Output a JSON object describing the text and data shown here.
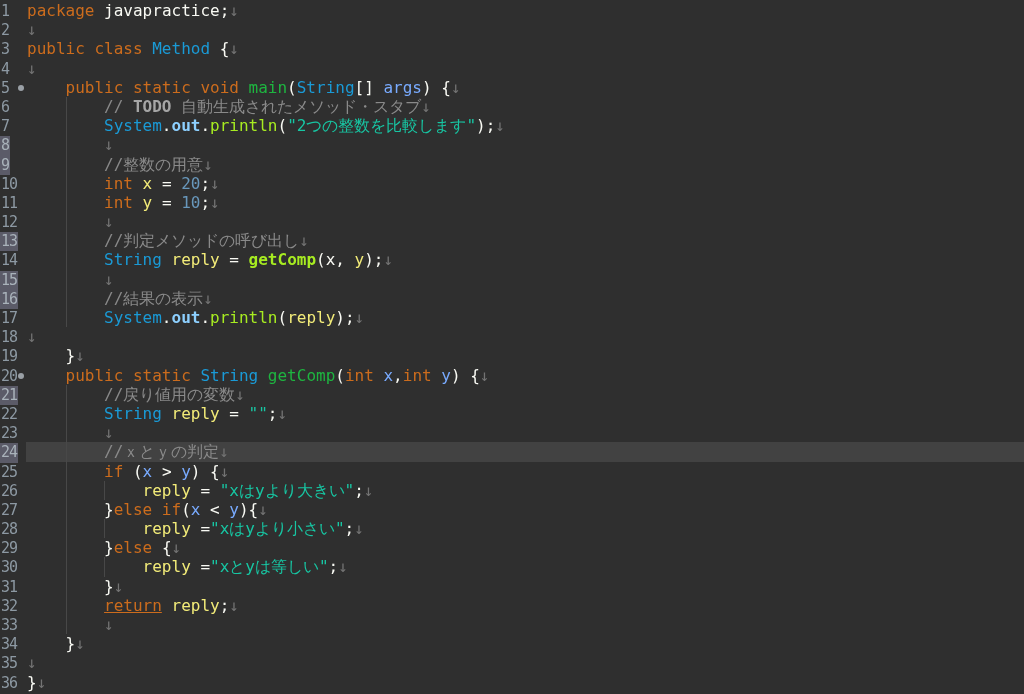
{
  "editor": {
    "lines": [
      {
        "number": "1",
        "marked": false,
        "current": false,
        "tokens": [
          {
            "kind": "keyword",
            "text": "package"
          },
          {
            "kind": "plain",
            "text": " javapractice;"
          },
          {
            "kind": "eol",
            "text": "↓"
          }
        ]
      },
      {
        "number": "2",
        "marked": false,
        "current": false,
        "tokens": [
          {
            "kind": "eol",
            "text": "↓"
          }
        ]
      },
      {
        "number": "3",
        "marked": false,
        "current": false,
        "tokens": [
          {
            "kind": "keyword",
            "text": "public class "
          },
          {
            "kind": "type",
            "text": "Method"
          },
          {
            "kind": "plain",
            "text": " {"
          },
          {
            "kind": "eol",
            "text": "↓"
          }
        ]
      },
      {
        "number": "4",
        "marked": false,
        "current": false,
        "tokens": [
          {
            "kind": "eol",
            "text": "↓"
          }
        ]
      },
      {
        "number": "5",
        "marked": false,
        "current": false,
        "fold": true,
        "tokens": [
          {
            "kind": "keyword",
            "text": "    public static void "
          },
          {
            "kind": "declaration",
            "text": "main"
          },
          {
            "kind": "plain",
            "text": "("
          },
          {
            "kind": "type",
            "text": "String"
          },
          {
            "kind": "plain",
            "text": "[] "
          },
          {
            "kind": "param",
            "text": "args"
          },
          {
            "kind": "plain",
            "text": ") {"
          },
          {
            "kind": "eol",
            "text": "↓"
          }
        ]
      },
      {
        "number": "6",
        "marked": false,
        "current": false,
        "tokens": [
          {
            "kind": "comment",
            "text": "        //"
          },
          {
            "kind": "todo",
            "text": " TODO"
          },
          {
            "kind": "comment",
            "text": " 自動生成されたメソッド・スタブ"
          },
          {
            "kind": "eol",
            "text": "↓"
          }
        ]
      },
      {
        "number": "7",
        "marked": false,
        "current": false,
        "tokens": [
          {
            "kind": "type",
            "text": "        System"
          },
          {
            "kind": "plain",
            "text": "."
          },
          {
            "kind": "field",
            "text": "out"
          },
          {
            "kind": "plain",
            "text": "."
          },
          {
            "kind": "call",
            "text": "println"
          },
          {
            "kind": "plain",
            "text": "("
          },
          {
            "kind": "string",
            "text": "\"2つの整数を比較します\""
          },
          {
            "kind": "plain",
            "text": ");"
          },
          {
            "kind": "eol",
            "text": "↓"
          }
        ]
      },
      {
        "number": "8",
        "marked": true,
        "current": false,
        "tokens": [
          {
            "kind": "eol",
            "text": "        ↓"
          }
        ]
      },
      {
        "number": "9",
        "marked": true,
        "current": false,
        "tokens": [
          {
            "kind": "comment",
            "text": "        //整数の用意"
          },
          {
            "kind": "eol",
            "text": "↓"
          }
        ]
      },
      {
        "number": "10",
        "marked": false,
        "current": false,
        "tokens": [
          {
            "kind": "keyword",
            "text": "        int "
          },
          {
            "kind": "local",
            "text": "x"
          },
          {
            "kind": "plain",
            "text": " = "
          },
          {
            "kind": "number",
            "text": "20"
          },
          {
            "kind": "plain",
            "text": ";"
          },
          {
            "kind": "eol",
            "text": "↓"
          }
        ]
      },
      {
        "number": "11",
        "marked": false,
        "current": false,
        "tokens": [
          {
            "kind": "keyword",
            "text": "        int "
          },
          {
            "kind": "local",
            "text": "y"
          },
          {
            "kind": "plain",
            "text": " = "
          },
          {
            "kind": "number",
            "text": "10"
          },
          {
            "kind": "plain",
            "text": ";"
          },
          {
            "kind": "eol",
            "text": "↓"
          }
        ]
      },
      {
        "number": "12",
        "marked": false,
        "current": false,
        "tokens": [
          {
            "kind": "eol",
            "text": "        ↓"
          }
        ]
      },
      {
        "number": "13",
        "marked": true,
        "current": false,
        "tokens": [
          {
            "kind": "comment",
            "text": "        //判定メソッドの呼び出し"
          },
          {
            "kind": "eol",
            "text": "↓"
          }
        ]
      },
      {
        "number": "14",
        "marked": false,
        "current": false,
        "tokens": [
          {
            "kind": "type",
            "text": "        String "
          },
          {
            "kind": "local",
            "text": "reply"
          },
          {
            "kind": "plain",
            "text": " = "
          },
          {
            "kind": "call-bold",
            "text": "getComp"
          },
          {
            "kind": "plain",
            "text": "(x, "
          },
          {
            "kind": "local",
            "text": "y"
          },
          {
            "kind": "plain",
            "text": ");"
          },
          {
            "kind": "eol",
            "text": "↓"
          }
        ]
      },
      {
        "number": "15",
        "marked": true,
        "current": false,
        "tokens": [
          {
            "kind": "eol",
            "text": "        ↓"
          }
        ]
      },
      {
        "number": "16",
        "marked": true,
        "current": false,
        "tokens": [
          {
            "kind": "comment",
            "text": "        //結果の表示"
          },
          {
            "kind": "eol",
            "text": "↓"
          }
        ]
      },
      {
        "number": "17",
        "marked": false,
        "current": false,
        "tokens": [
          {
            "kind": "type",
            "text": "        System"
          },
          {
            "kind": "plain",
            "text": "."
          },
          {
            "kind": "field",
            "text": "out"
          },
          {
            "kind": "plain",
            "text": "."
          },
          {
            "kind": "call",
            "text": "println"
          },
          {
            "kind": "plain",
            "text": "("
          },
          {
            "kind": "local",
            "text": "reply"
          },
          {
            "kind": "plain",
            "text": ");"
          },
          {
            "kind": "eol",
            "text": "↓"
          }
        ]
      },
      {
        "number": "18",
        "marked": false,
        "current": false,
        "tokens": [
          {
            "kind": "eol",
            "text": "↓"
          }
        ]
      },
      {
        "number": "19",
        "marked": false,
        "current": false,
        "tokens": [
          {
            "kind": "plain",
            "text": "    }"
          },
          {
            "kind": "eol",
            "text": "↓"
          }
        ]
      },
      {
        "number": "20",
        "marked": false,
        "current": false,
        "fold": true,
        "tokens": [
          {
            "kind": "keyword",
            "text": "    public static "
          },
          {
            "kind": "type",
            "text": "String "
          },
          {
            "kind": "declaration",
            "text": "getComp"
          },
          {
            "kind": "plain",
            "text": "("
          },
          {
            "kind": "keyword",
            "text": "int "
          },
          {
            "kind": "param",
            "text": "x"
          },
          {
            "kind": "plain",
            "text": ","
          },
          {
            "kind": "keyword",
            "text": "int "
          },
          {
            "kind": "param",
            "text": "y"
          },
          {
            "kind": "plain",
            "text": ") {"
          },
          {
            "kind": "eol",
            "text": "↓"
          }
        ]
      },
      {
        "number": "21",
        "marked": true,
        "current": false,
        "tokens": [
          {
            "kind": "comment",
            "text": "        //戻り値用の変数"
          },
          {
            "kind": "eol",
            "text": "↓"
          }
        ]
      },
      {
        "number": "22",
        "marked": false,
        "current": false,
        "tokens": [
          {
            "kind": "type",
            "text": "        String "
          },
          {
            "kind": "local",
            "text": "reply"
          },
          {
            "kind": "plain",
            "text": " = "
          },
          {
            "kind": "string",
            "text": "\"\""
          },
          {
            "kind": "plain",
            "text": ";"
          },
          {
            "kind": "eol",
            "text": "↓"
          }
        ]
      },
      {
        "number": "23",
        "marked": false,
        "current": false,
        "tokens": [
          {
            "kind": "eol",
            "text": "        ↓"
          }
        ]
      },
      {
        "number": "24",
        "marked": true,
        "current": true,
        "tokens": [
          {
            "kind": "comment",
            "text": "        //ｘとｙの判定"
          },
          {
            "kind": "eol",
            "text": "↓"
          }
        ]
      },
      {
        "number": "25",
        "marked": false,
        "current": false,
        "tokens": [
          {
            "kind": "keyword",
            "text": "        if"
          },
          {
            "kind": "plain",
            "text": " ("
          },
          {
            "kind": "param",
            "text": "x"
          },
          {
            "kind": "plain",
            "text": " > "
          },
          {
            "kind": "param",
            "text": "y"
          },
          {
            "kind": "plain",
            "text": ") {"
          },
          {
            "kind": "eol",
            "text": "↓"
          }
        ]
      },
      {
        "number": "26",
        "marked": false,
        "current": false,
        "tokens": [
          {
            "kind": "local",
            "text": "            reply"
          },
          {
            "kind": "plain",
            "text": " = "
          },
          {
            "kind": "string",
            "text": "\"xはyより大きい\""
          },
          {
            "kind": "plain",
            "text": ";"
          },
          {
            "kind": "eol",
            "text": "↓"
          }
        ]
      },
      {
        "number": "27",
        "marked": false,
        "current": false,
        "tokens": [
          {
            "kind": "plain",
            "text": "        }"
          },
          {
            "kind": "keyword",
            "text": "else if"
          },
          {
            "kind": "plain",
            "text": "("
          },
          {
            "kind": "param",
            "text": "x"
          },
          {
            "kind": "plain",
            "text": " < "
          },
          {
            "kind": "param",
            "text": "y"
          },
          {
            "kind": "plain",
            "text": "){"
          },
          {
            "kind": "eol",
            "text": "↓"
          }
        ]
      },
      {
        "number": "28",
        "marked": false,
        "current": false,
        "tokens": [
          {
            "kind": "local",
            "text": "            reply"
          },
          {
            "kind": "plain",
            "text": " ="
          },
          {
            "kind": "string",
            "text": "\"xはyより小さい\""
          },
          {
            "kind": "plain",
            "text": ";"
          },
          {
            "kind": "eol",
            "text": "↓"
          }
        ]
      },
      {
        "number": "29",
        "marked": false,
        "current": false,
        "tokens": [
          {
            "kind": "plain",
            "text": "        }"
          },
          {
            "kind": "keyword",
            "text": "else"
          },
          {
            "kind": "plain",
            "text": " {"
          },
          {
            "kind": "eol",
            "text": "↓"
          }
        ]
      },
      {
        "number": "30",
        "marked": false,
        "current": false,
        "tokens": [
          {
            "kind": "local",
            "text": "            reply"
          },
          {
            "kind": "plain",
            "text": " ="
          },
          {
            "kind": "string",
            "text": "\"xとyは等しい\""
          },
          {
            "kind": "plain",
            "text": ";"
          },
          {
            "kind": "eol",
            "text": "↓"
          }
        ]
      },
      {
        "number": "31",
        "marked": false,
        "current": false,
        "tokens": [
          {
            "kind": "plain",
            "text": "        }"
          },
          {
            "kind": "eol",
            "text": "↓"
          }
        ]
      },
      {
        "number": "32",
        "marked": false,
        "current": false,
        "tokens": [
          {
            "kind": "return",
            "text": "        return"
          },
          {
            "kind": "local",
            "text": " reply"
          },
          {
            "kind": "plain",
            "text": ";"
          },
          {
            "kind": "eol",
            "text": "↓"
          }
        ]
      },
      {
        "number": "33",
        "marked": false,
        "current": false,
        "tokens": [
          {
            "kind": "eol",
            "text": "        ↓"
          }
        ]
      },
      {
        "number": "34",
        "marked": false,
        "current": false,
        "tokens": [
          {
            "kind": "plain",
            "text": "    }"
          },
          {
            "kind": "eol",
            "text": "↓"
          }
        ]
      },
      {
        "number": "35",
        "marked": false,
        "current": false,
        "tokens": [
          {
            "kind": "eol",
            "text": "↓"
          }
        ]
      },
      {
        "number": "36",
        "marked": false,
        "current": false,
        "tokens": [
          {
            "kind": "plain",
            "text": "}"
          },
          {
            "kind": "eol",
            "text": "↓"
          }
        ]
      }
    ]
  }
}
